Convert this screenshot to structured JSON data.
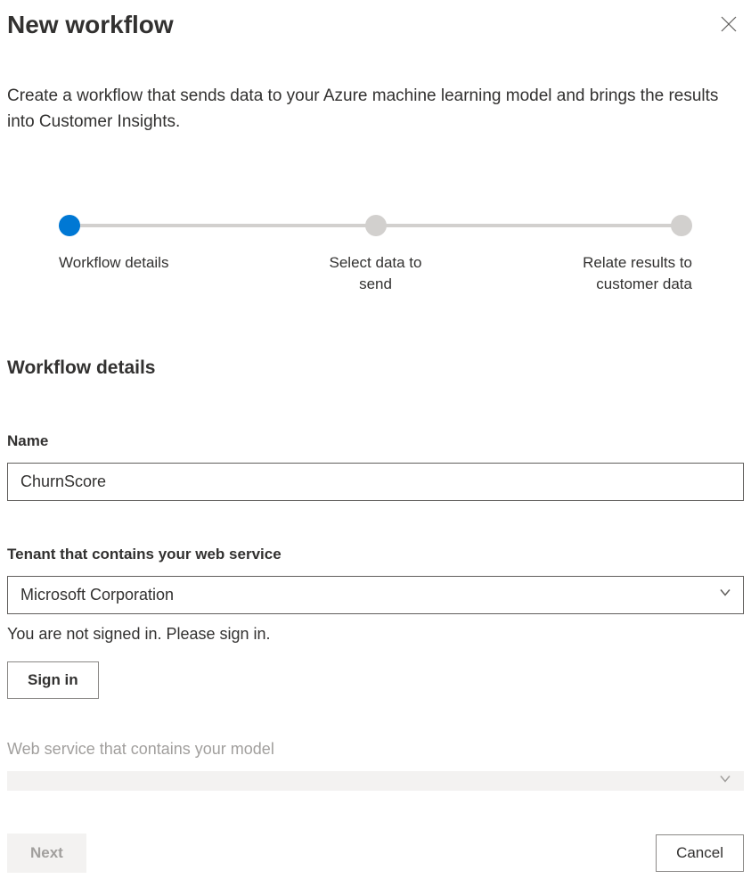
{
  "header": {
    "title": "New workflow"
  },
  "description": "Create a workflow that sends data to your Azure machine learning model and brings the results into Customer Insights.",
  "stepper": {
    "steps": [
      {
        "label": "Workflow details",
        "active": true
      },
      {
        "label": "Select data to send",
        "active": false
      },
      {
        "label": "Relate results to customer data",
        "active": false
      }
    ]
  },
  "section": {
    "title": "Workflow details"
  },
  "fields": {
    "name": {
      "label": "Name",
      "value": "ChurnScore"
    },
    "tenant": {
      "label": "Tenant that contains your web service",
      "value": "Microsoft Corporation",
      "helper": "You are not signed in. Please sign in.",
      "signin_label": "Sign in"
    },
    "webservice": {
      "label": "Web service that contains your model",
      "value": ""
    }
  },
  "footer": {
    "next_label": "Next",
    "cancel_label": "Cancel"
  }
}
